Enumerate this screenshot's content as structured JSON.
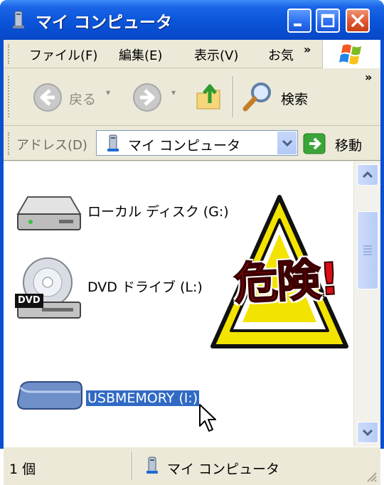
{
  "window": {
    "title": "マイ コンピュータ",
    "title_icon": "my-computer-icon"
  },
  "menu": {
    "items": [
      "ファイル(F)",
      "編集(E)",
      "表示(V)",
      "お気"
    ],
    "overflow": "»"
  },
  "toolbar": {
    "back_label": "戻る",
    "search_label": "検索",
    "overflow": "»"
  },
  "address": {
    "label": "アドレス(D)",
    "value": "マイ コンピュータ",
    "go_label": "移動"
  },
  "drives": [
    {
      "label": "ローカル ディスク (G:)",
      "icon": "hard-disk-icon"
    },
    {
      "label": "DVD ドライブ (L:)",
      "icon": "dvd-drive-icon",
      "badge": "DVD"
    },
    {
      "label": "USBMEMORY (I:)",
      "icon": "usb-drive-icon",
      "selected": true
    }
  ],
  "overlay": {
    "warning_text": "危険!",
    "warning_icon": "warning-triangle-icon"
  },
  "status": {
    "count": "1 個",
    "location": "マイ コンピュータ"
  },
  "colors": {
    "title_bar": "#0a54d9",
    "selection": "#316ac5",
    "warning_red": "#d70e16",
    "warning_yellow": "#f5e600"
  }
}
